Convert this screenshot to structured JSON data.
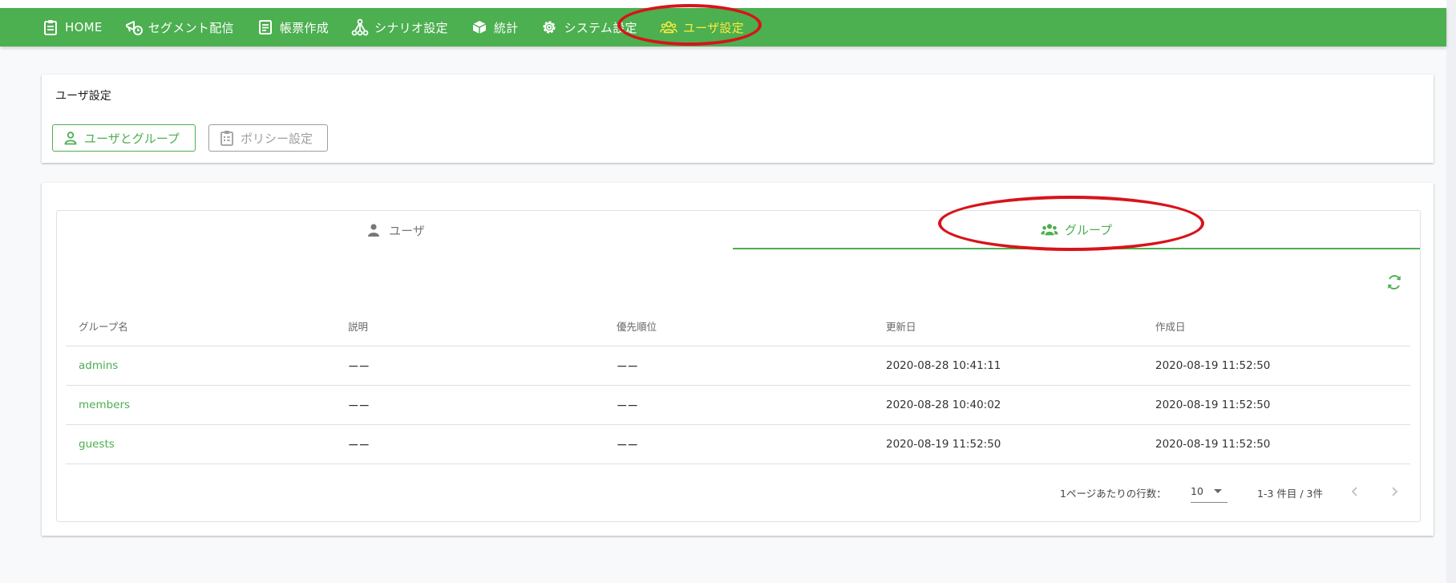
{
  "nav": {
    "items": [
      {
        "label": "HOME",
        "icon": "clipboard-icon"
      },
      {
        "label": "セグメント配信",
        "icon": "megaphone-clock-icon"
      },
      {
        "label": "帳票作成",
        "icon": "document-icon"
      },
      {
        "label": "シナリオ設定",
        "icon": "tree-nodes-icon"
      },
      {
        "label": "統計",
        "icon": "cube-icon"
      },
      {
        "label": "システム設定",
        "icon": "gear-icon"
      },
      {
        "label": "ユーザ設定",
        "icon": "users-icon",
        "active": true
      }
    ]
  },
  "settings_card": {
    "title": "ユーザ設定",
    "users_button": "ユーザとグループ",
    "policy_button": "ポリシー設定"
  },
  "tabs": {
    "user": "ユーザ",
    "group": "グループ",
    "active": "group"
  },
  "table": {
    "headers": [
      "グループ名",
      "説明",
      "優先順位",
      "更新日",
      "作成日"
    ],
    "rows": [
      {
        "name": "admins",
        "description": "ーー",
        "priority": "ーー",
        "updated": "2020-08-28 10:41:11",
        "created": "2020-08-19 11:52:50"
      },
      {
        "name": "members",
        "description": "ーー",
        "priority": "ーー",
        "updated": "2020-08-28 10:40:02",
        "created": "2020-08-19 11:52:50"
      },
      {
        "name": "guests",
        "description": "ーー",
        "priority": "ーー",
        "updated": "2020-08-19 11:52:50",
        "created": "2020-08-19 11:52:50"
      }
    ]
  },
  "pagination": {
    "rows_per_page_label": "1ページあたりの行数：",
    "rows_per_page": "10",
    "range": "1-3 件目 / 3件"
  },
  "colors": {
    "accent": "#4caf50",
    "active_nav": "#ffeb3b",
    "annotation": "#d7141a"
  }
}
